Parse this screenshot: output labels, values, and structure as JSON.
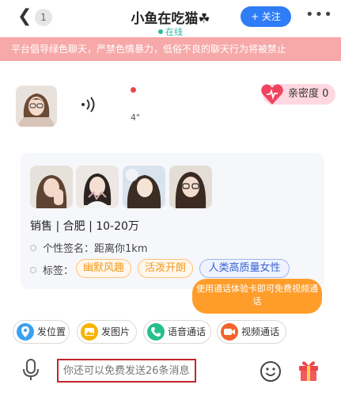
{
  "header": {
    "back_count": "1",
    "title": "小鱼在吃猫☘",
    "status": "在线",
    "follow_label": "+ 关注",
    "more_label": "•••"
  },
  "banner": {
    "text": "平台倡导绿色聊天，严禁色情暴力，低俗不良的聊天行为将被禁止"
  },
  "voice_message": {
    "duration": "4\""
  },
  "intimacy": {
    "label": "亲密度 0"
  },
  "profile": {
    "job_line": "销售 | 合肥 | 10-20万",
    "signature_label": "个性签名：",
    "signature_value": "距离你1km",
    "tags_label": "标签：",
    "tags": [
      "幽默风趣",
      "活泼开朗",
      "人类高质量女性"
    ]
  },
  "tooltip": {
    "text": "使用通话体验卡即可免费视频通话"
  },
  "actions": [
    {
      "label": "发位置",
      "icon": "location-icon",
      "color": "#3aa0f0"
    },
    {
      "label": "发图片",
      "icon": "image-icon",
      "color": "#f5b400"
    },
    {
      "label": "语音通话",
      "icon": "phone-icon",
      "color": "#27c08a"
    },
    {
      "label": "视频通话",
      "icon": "video-icon",
      "color": "#f2642b"
    }
  ],
  "input": {
    "placeholder": "你还可以免费发送26条消息"
  },
  "colors": {
    "accent": "#2f7df6",
    "banner": "#f7a8a8",
    "tooltip": "#ff9d2b",
    "online": "#2fb8a0"
  }
}
